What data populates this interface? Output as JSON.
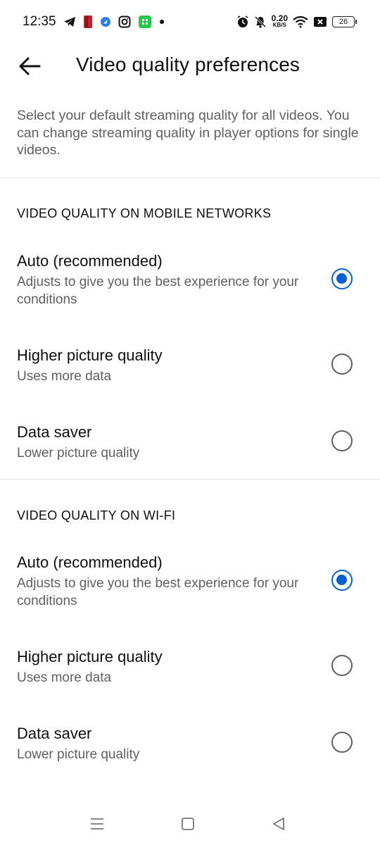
{
  "status_bar": {
    "time": "12:35",
    "net_speed_value": "0.20",
    "net_speed_unit": "KB/S",
    "battery": "26",
    "icons_left": [
      "telegram-icon",
      "app-red-icon",
      "app-blue-icon",
      "instagram-icon",
      "app-green-icon",
      "dot-icon"
    ],
    "icons_right": [
      "alarm-icon",
      "mute-bell-icon",
      "wifi-icon",
      "sim-x-icon",
      "battery-icon"
    ]
  },
  "header": {
    "title": "Video quality preferences",
    "back_icon": "arrow-left-icon"
  },
  "description": "Select your default streaming quality for all videos. You can change streaming quality in player options for single videos.",
  "sections": [
    {
      "heading": "VIDEO QUALITY ON MOBILE NETWORKS",
      "options": [
        {
          "title": "Auto (recommended)",
          "subtitle": "Adjusts to give you the best experience for your conditions",
          "selected": true
        },
        {
          "title": "Higher picture quality",
          "subtitle": "Uses more data",
          "selected": false
        },
        {
          "title": "Data saver",
          "subtitle": "Lower picture quality",
          "selected": false
        }
      ]
    },
    {
      "heading": "VIDEO QUALITY ON WI-FI",
      "options": [
        {
          "title": "Auto (recommended)",
          "subtitle": "Adjusts to give you the best experience for your conditions",
          "selected": true
        },
        {
          "title": "Higher picture quality",
          "subtitle": "Uses more data",
          "selected": false
        },
        {
          "title": "Data saver",
          "subtitle": "Lower picture quality",
          "selected": false
        }
      ]
    }
  ],
  "nav_bar": {
    "icons": [
      "menu-icon",
      "home-icon",
      "back-triangle-icon"
    ]
  },
  "colors": {
    "accent": "#065fd4",
    "primary_text": "#0f0f0f",
    "secondary_text": "#606060",
    "divider": "#e6e6e6"
  }
}
